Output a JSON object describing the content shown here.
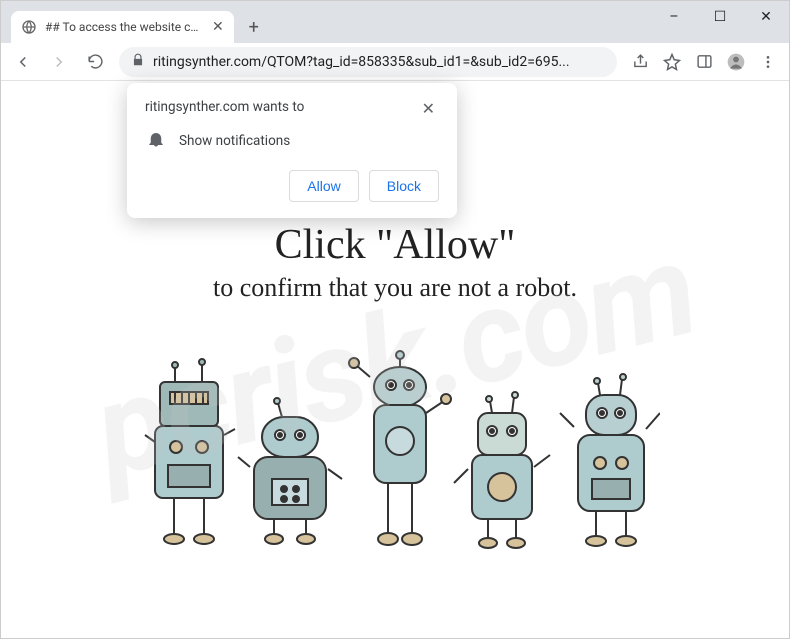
{
  "window": {
    "minimize": "–",
    "maximize": "☐",
    "close": "✕"
  },
  "tab": {
    "title": "## To access the website click the",
    "close": "✕"
  },
  "nav": {
    "back": "←",
    "forward": "→",
    "reload": "⟳"
  },
  "address": {
    "url": "ritingsynther.com/QTOM?tag_id=858335&sub_id1=&sub_id2=695..."
  },
  "permission": {
    "domain_line": "ritingsynther.com wants to",
    "item": "Show notifications",
    "allow": "Allow",
    "block": "Block",
    "close": "✕"
  },
  "page": {
    "headline": "Click \"Allow\"",
    "subline": "to confirm that you are not a robot."
  },
  "watermark": "pcrisk.com"
}
